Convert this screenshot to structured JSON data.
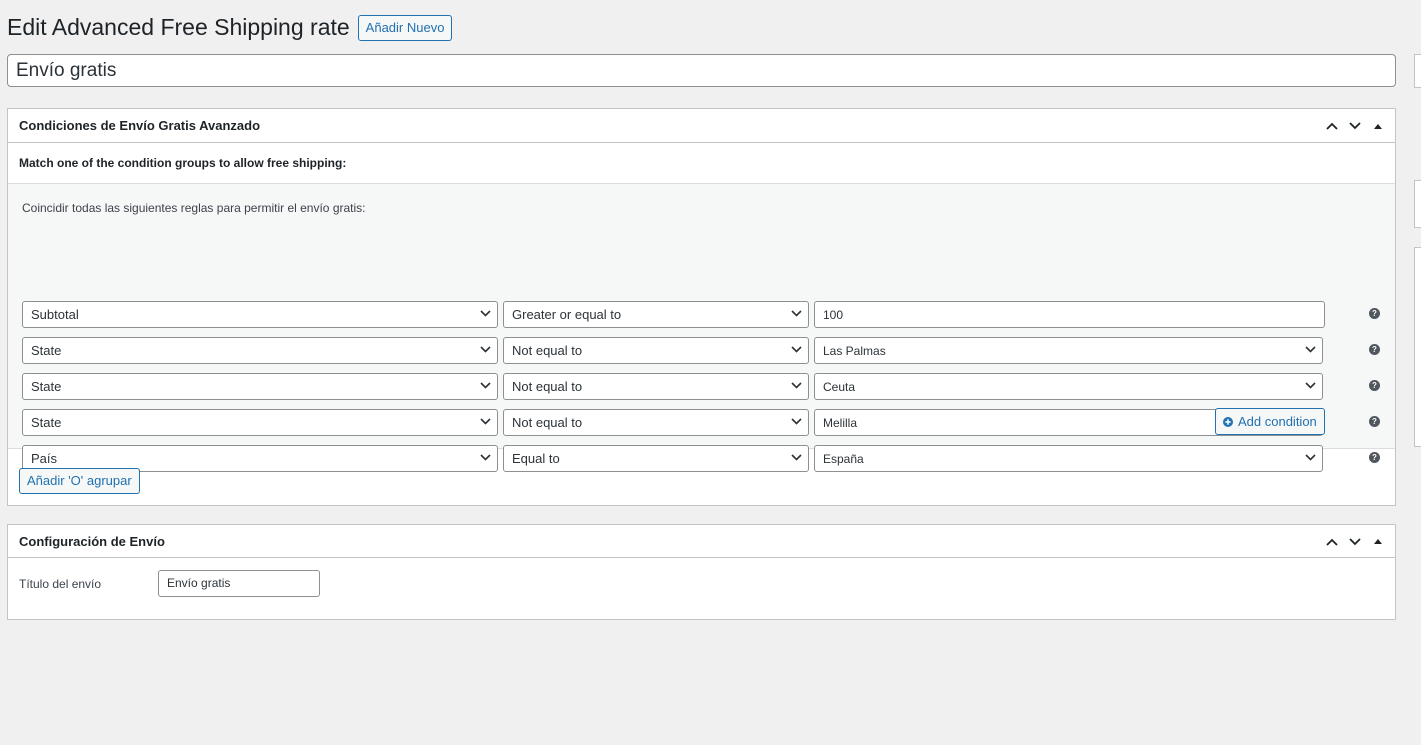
{
  "header": {
    "title": "Edit Advanced Free Shipping rate",
    "add_new_label": "Añadir Nuevo"
  },
  "post_title": "Envío gratis",
  "conditions_box": {
    "title": "Condiciones de Envío Gratis Avanzado",
    "match_text": "Match one of the condition groups to allow free shipping:",
    "group_label": "Coincidir todas las siguientes reglas para permitir el envío gratis:",
    "rows": [
      {
        "condition": "Subtotal",
        "operator": "Greater or equal to",
        "value": "100",
        "value_type": "text"
      },
      {
        "condition": "State",
        "operator": "Not equal to",
        "value": "Las Palmas",
        "value_type": "select"
      },
      {
        "condition": "State",
        "operator": "Not equal to",
        "value": "Ceuta",
        "value_type": "select"
      },
      {
        "condition": "State",
        "operator": "Not equal to",
        "value": "Melilla",
        "value_type": "select"
      },
      {
        "condition": "País",
        "operator": "Equal to",
        "value": "España",
        "value_type": "select"
      }
    ],
    "add_condition_label": "Add condition",
    "add_or_group_label": "Añadir 'O' agrupar"
  },
  "shipping_box": {
    "title": "Configuración de Envío",
    "shipping_title_label": "Título del envío",
    "shipping_title_value": "Envío gratis"
  },
  "help_glyph": "?"
}
